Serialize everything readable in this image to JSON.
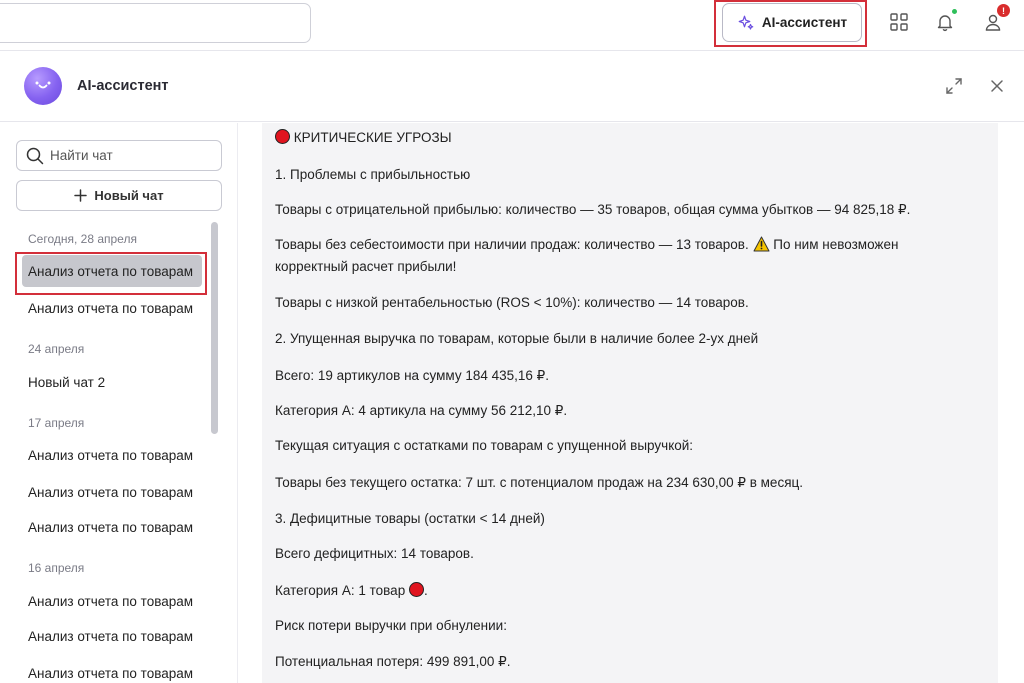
{
  "topbar": {
    "ai_button_label": "AI-ассистент",
    "notification_badge": "!"
  },
  "panel": {
    "title": "AI-ассистент"
  },
  "sidebar": {
    "search_placeholder": "Найти чат",
    "new_chat_label": "Новый чат",
    "groups": [
      {
        "label": "Сегодня, 28 апреля",
        "items": [
          "Анализ отчета по товарам",
          "Анализ отчета по товарам"
        ]
      },
      {
        "label": "24 апреля",
        "items": [
          "Новый чат 2"
        ]
      },
      {
        "label": "17 апреля",
        "items": [
          "Анализ отчета по товарам",
          "Анализ отчета по товарам",
          "Анализ отчета по товарам"
        ]
      },
      {
        "label": "16 апреля",
        "items": [
          "Анализ отчета по товарам",
          "Анализ отчета по товарам",
          "Анализ отчета по товарам"
        ]
      }
    ]
  },
  "message": {
    "heading": "КРИТИЧЕСКИЕ УГРОЗЫ",
    "lines": [
      "1. Проблемы с прибыльностью",
      "Товары с отрицательной прибылью: количество — 35 товаров, общая сумма убытков — 94 825,18 ₽.",
      "Товары без себестоимости при наличии продаж: количество — 13 товаров.",
      "По ним невозможен",
      "корректный расчет прибыли!",
      "Товары с низкой рентабельностью (ROS < 10%): количество — 14 товаров.",
      "2. Упущенная выручка по товарам, которые были в наличие более 2-ух дней",
      "Всего: 19 артикулов на сумму 184 435,16 ₽.",
      "Категория A: 4 артикула на сумму 56 212,10 ₽.",
      "Текущая ситуация с остатками по товарам с упущенной выручкой:",
      "Товары без текущего остатка: 7 шт. с потенциалом продаж на 234 630,00 ₽ в месяц.",
      "3. Дефицитные товары (остатки < 14 дней)",
      "Всего дефицитных: 14 товаров.",
      "Категория A: 1 товар",
      "Риск потери выручки при обнулении:",
      "Потенциальная потеря: 499 891,00 ₽."
    ]
  },
  "colors": {
    "accent": "#7b5cf0",
    "highlight_border": "#d32f3a",
    "status_online": "#2fbf5a",
    "danger": "#e0141f"
  }
}
